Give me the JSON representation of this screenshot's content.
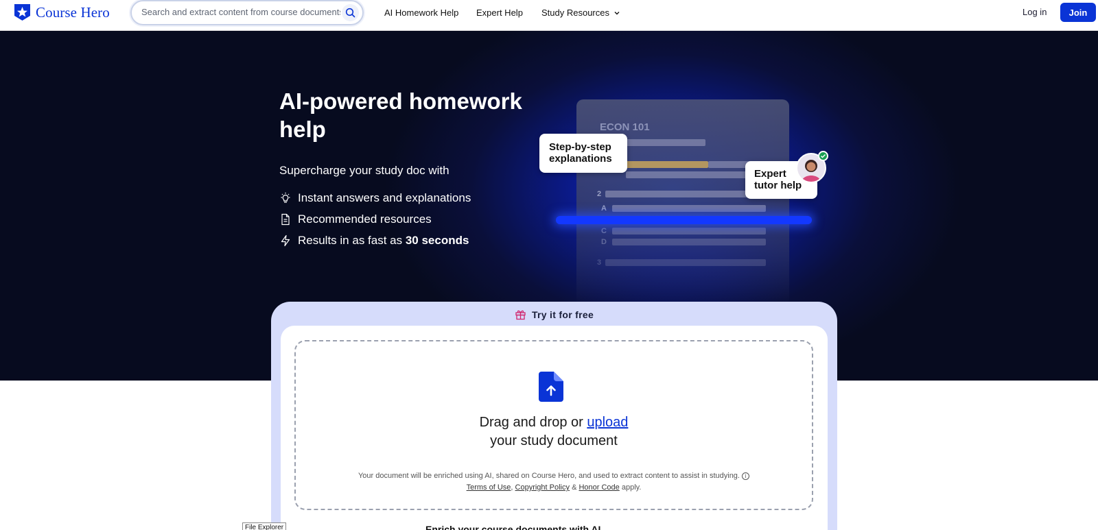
{
  "header": {
    "logo_text": "Course Hero",
    "search_placeholder": "Search and extract content from course documents, study guides & more",
    "nav": [
      {
        "label": "AI Homework Help"
      },
      {
        "label": "Expert Help"
      },
      {
        "label": "Study Resources"
      }
    ],
    "login_label": "Log in",
    "join_label": "Join"
  },
  "hero": {
    "title": "AI-powered homework help",
    "subtitle": "Supercharge your study doc with",
    "bullets": [
      {
        "icon": "lightbulb-icon",
        "text": "Instant answers and explanations"
      },
      {
        "icon": "document-icon",
        "text": "Recommended resources"
      },
      {
        "icon": "bolt-icon",
        "text_prefix": "Results in as fast as ",
        "text_bold": "30 seconds"
      }
    ],
    "mock_doc": {
      "course": "ECON 101",
      "numbers": [
        "2",
        "A",
        "C",
        "D",
        "3"
      ]
    },
    "card_step": "Step-by-step explanations",
    "card_tutor": "Expert tutor help"
  },
  "upload": {
    "try_label": "Try it for free",
    "drag_prefix": "Drag and drop or ",
    "upload_link": "upload",
    "drag_suffix": "your study document",
    "disclaimer": "Your document will be enriched using AI, shared on Course Hero, and used to extract content to assist in studying.",
    "terms": "Terms of Use",
    "copyright": "Copyright Policy",
    "amp": "&",
    "honor": "Honor Code",
    "apply": "apply."
  },
  "teaser": "Enrich your course documents with AI",
  "tooltip": "File Explorer",
  "colors": {
    "brand": "#0a34d6",
    "hero_bg": "#070b1f",
    "panel_bg": "#d6dcfb"
  }
}
